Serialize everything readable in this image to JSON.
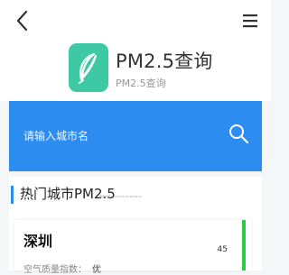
{
  "topbar": {
    "back_icon": "chevron-left-icon",
    "menu_icon": "hamburger-icon"
  },
  "header": {
    "title": "PM2.5查询",
    "subtitle": "PM2.5查询",
    "logo_icon": "feather-icon",
    "logo_color": "#3cc9a4"
  },
  "search": {
    "placeholder": "请输入城市名",
    "icon": "search-icon",
    "accent": "#2d8cf0"
  },
  "section": {
    "title": "热门城市PM2.5",
    "update_time": "更新时间：2025-04-29 06:54:12"
  },
  "cities": [
    {
      "name": "深圳",
      "aqi_label": "空气质量指数：",
      "aqi_level": "优",
      "pm25": "45",
      "level_color": "#2ecc40"
    }
  ]
}
